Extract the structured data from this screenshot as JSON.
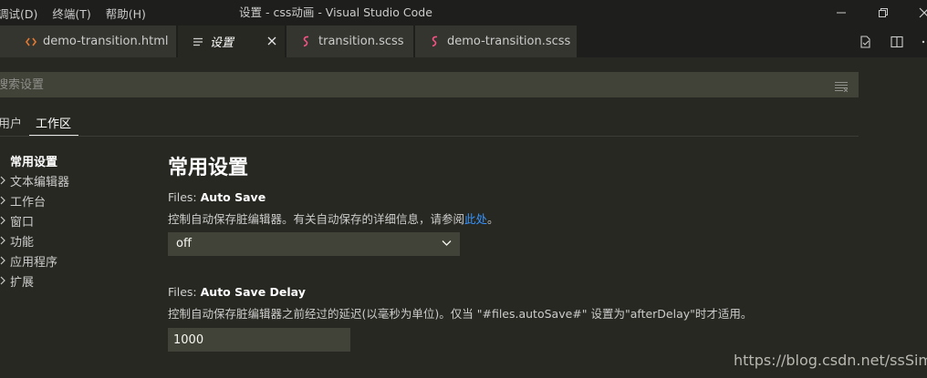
{
  "menubar": {
    "items": [
      "调试(D)",
      "终端(T)",
      "帮助(H)"
    ]
  },
  "window": {
    "title": "设置 - css动画 - Visual Studio Code",
    "controls": [
      "minimize-icon",
      "restore-icon",
      "close-icon"
    ]
  },
  "tabs": [
    {
      "label": "demo-transition.html",
      "icon": "html-file-icon",
      "active": false
    },
    {
      "label": "设置",
      "icon": "settings-file-icon",
      "active": true
    },
    {
      "label": "transition.scss",
      "icon": "scss-file-icon",
      "active": false
    },
    {
      "label": "demo-transition.scss",
      "icon": "scss-file-icon",
      "active": false
    }
  ],
  "editor_actions": [
    "open-settings-json-icon",
    "split-editor-icon",
    "more-actions-icon"
  ],
  "search": {
    "placeholder": "搜索设置",
    "value": ""
  },
  "scope_tabs": {
    "user": "用户",
    "workspace": "工作区",
    "active": "工作区"
  },
  "toc": {
    "items": [
      "常用设置",
      "文本编辑器",
      "工作台",
      "窗口",
      "功能",
      "应用程序",
      "扩展"
    ]
  },
  "main": {
    "section_title": "常用设置",
    "auto_save": {
      "category": "Files: ",
      "key": "Auto Save",
      "description_prefix": "控制自动保存脏编辑器。有关自动保存的详细信息，请参阅",
      "link": "此处",
      "description_suffix": "。",
      "value": "off"
    },
    "auto_save_delay": {
      "category": "Files: ",
      "key": "Auto Save Delay",
      "description": "控制自动保存脏编辑器之前经过的延迟(以毫秒为单位)。仅当 \"#files.autoSave#\" 设置为\"afterDelay\"时才适用。",
      "value": "1000"
    }
  },
  "watermark": "https://blog.csdn.net/ssSimle",
  "colors": {
    "background": "#272822",
    "titlebar": "#1e1f1c",
    "inactive_tab": "#34352f",
    "input": "#414339",
    "link": "#3794ff",
    "html_icon": "#e37933",
    "scss_icon": "#f55385"
  }
}
